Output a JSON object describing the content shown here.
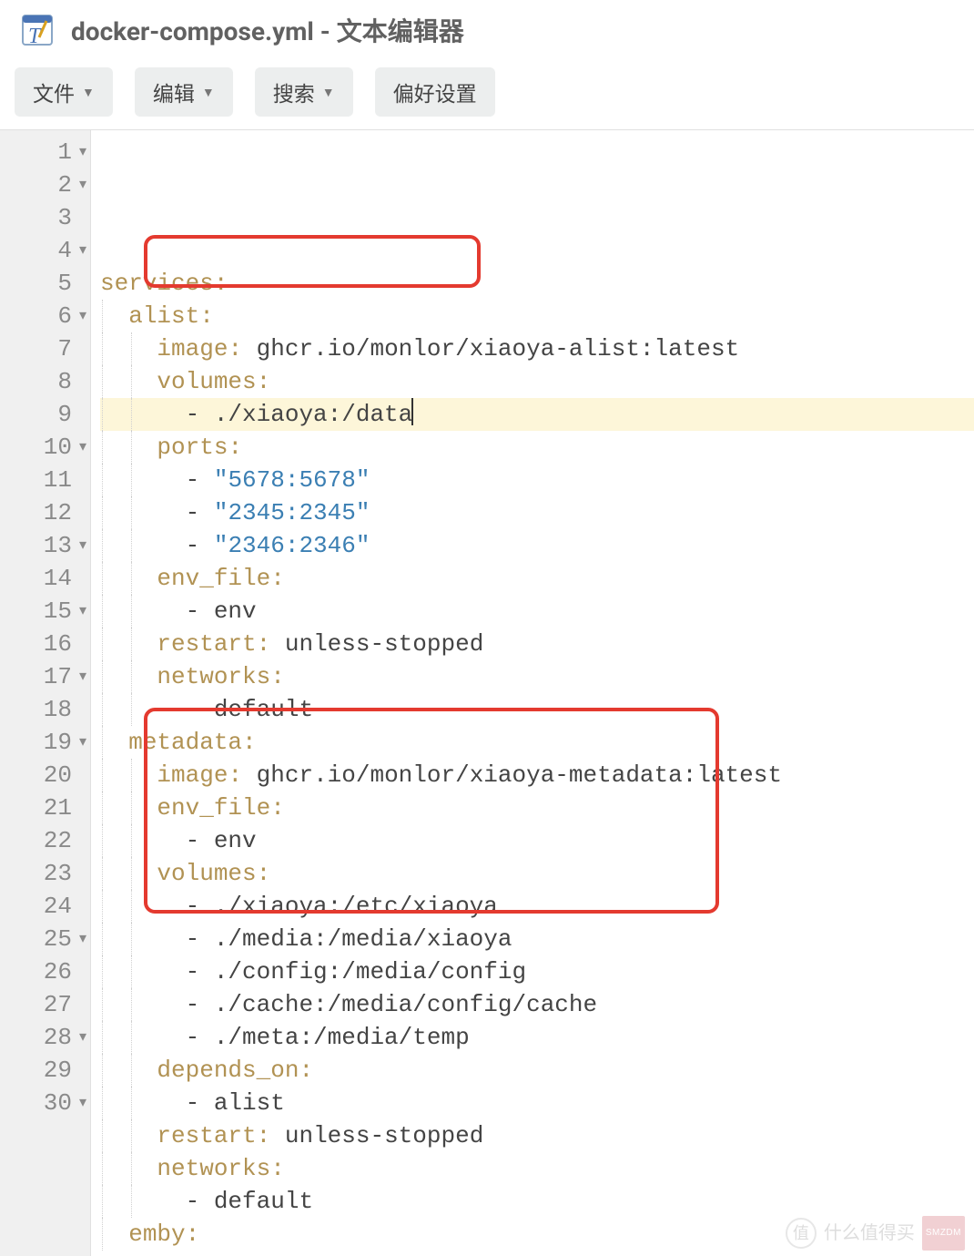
{
  "window": {
    "title": "docker-compose.yml - 文本编辑器"
  },
  "menubar": {
    "file": "文件",
    "edit": "编辑",
    "search": "搜索",
    "prefs": "偏好设置"
  },
  "lines": [
    {
      "n": "1",
      "fold": true,
      "hl": false,
      "indent": 0,
      "segs": [
        {
          "t": "key",
          "v": "services"
        },
        {
          "t": "key",
          "v": ":"
        }
      ]
    },
    {
      "n": "2",
      "fold": true,
      "hl": false,
      "indent": 1,
      "segs": [
        {
          "t": "key",
          "v": "alist"
        },
        {
          "t": "key",
          "v": ":"
        }
      ]
    },
    {
      "n": "3",
      "fold": false,
      "hl": false,
      "indent": 2,
      "segs": [
        {
          "t": "key",
          "v": "image"
        },
        {
          "t": "key",
          "v": ": "
        },
        {
          "t": "plain",
          "v": "ghcr.io/monlor/xiaoya-alist:latest"
        }
      ]
    },
    {
      "n": "4",
      "fold": true,
      "hl": false,
      "indent": 2,
      "segs": [
        {
          "t": "key",
          "v": "volumes"
        },
        {
          "t": "key",
          "v": ":"
        }
      ]
    },
    {
      "n": "5",
      "fold": false,
      "hl": true,
      "indent": 3,
      "cursor": true,
      "segs": [
        {
          "t": "plain",
          "v": "- ./xiaoya:/data"
        }
      ]
    },
    {
      "n": "6",
      "fold": true,
      "hl": false,
      "indent": 2,
      "segs": [
        {
          "t": "key",
          "v": "ports"
        },
        {
          "t": "key",
          "v": ":"
        }
      ]
    },
    {
      "n": "7",
      "fold": false,
      "hl": false,
      "indent": 3,
      "segs": [
        {
          "t": "plain",
          "v": "- "
        },
        {
          "t": "str",
          "v": "\"5678:5678\""
        }
      ]
    },
    {
      "n": "8",
      "fold": false,
      "hl": false,
      "indent": 3,
      "segs": [
        {
          "t": "plain",
          "v": "- "
        },
        {
          "t": "str",
          "v": "\"2345:2345\""
        }
      ]
    },
    {
      "n": "9",
      "fold": false,
      "hl": false,
      "indent": 3,
      "segs": [
        {
          "t": "plain",
          "v": "- "
        },
        {
          "t": "str",
          "v": "\"2346:2346\""
        }
      ]
    },
    {
      "n": "10",
      "fold": true,
      "hl": false,
      "indent": 2,
      "segs": [
        {
          "t": "key",
          "v": "env_file"
        },
        {
          "t": "key",
          "v": ":"
        }
      ]
    },
    {
      "n": "11",
      "fold": false,
      "hl": false,
      "indent": 3,
      "segs": [
        {
          "t": "plain",
          "v": "- env"
        }
      ]
    },
    {
      "n": "12",
      "fold": false,
      "hl": false,
      "indent": 2,
      "segs": [
        {
          "t": "key",
          "v": "restart"
        },
        {
          "t": "key",
          "v": ": "
        },
        {
          "t": "plain",
          "v": "unless-stopped"
        }
      ]
    },
    {
      "n": "13",
      "fold": true,
      "hl": false,
      "indent": 2,
      "segs": [
        {
          "t": "key",
          "v": "networks"
        },
        {
          "t": "key",
          "v": ":"
        }
      ]
    },
    {
      "n": "14",
      "fold": false,
      "hl": false,
      "indent": 3,
      "segs": [
        {
          "t": "plain",
          "v": "- default"
        }
      ]
    },
    {
      "n": "15",
      "fold": true,
      "hl": false,
      "indent": 1,
      "segs": [
        {
          "t": "key",
          "v": "metadata"
        },
        {
          "t": "key",
          "v": ":"
        }
      ]
    },
    {
      "n": "16",
      "fold": false,
      "hl": false,
      "indent": 2,
      "segs": [
        {
          "t": "key",
          "v": "image"
        },
        {
          "t": "key",
          "v": ": "
        },
        {
          "t": "plain",
          "v": "ghcr.io/monlor/xiaoya-metadata:latest"
        }
      ]
    },
    {
      "n": "17",
      "fold": true,
      "hl": false,
      "indent": 2,
      "segs": [
        {
          "t": "key",
          "v": "env_file"
        },
        {
          "t": "key",
          "v": ":"
        }
      ]
    },
    {
      "n": "18",
      "fold": false,
      "hl": false,
      "indent": 3,
      "segs": [
        {
          "t": "plain",
          "v": "- env"
        }
      ]
    },
    {
      "n": "19",
      "fold": true,
      "hl": false,
      "indent": 2,
      "segs": [
        {
          "t": "key",
          "v": "volumes"
        },
        {
          "t": "key",
          "v": ":"
        }
      ]
    },
    {
      "n": "20",
      "fold": false,
      "hl": false,
      "indent": 3,
      "segs": [
        {
          "t": "plain",
          "v": "- ./xiaoya:/etc/xiaoya"
        }
      ]
    },
    {
      "n": "21",
      "fold": false,
      "hl": false,
      "indent": 3,
      "segs": [
        {
          "t": "plain",
          "v": "- ./media:/media/xiaoya"
        }
      ]
    },
    {
      "n": "22",
      "fold": false,
      "hl": false,
      "indent": 3,
      "segs": [
        {
          "t": "plain",
          "v": "- ./config:/media/config"
        }
      ]
    },
    {
      "n": "23",
      "fold": false,
      "hl": false,
      "indent": 3,
      "segs": [
        {
          "t": "plain",
          "v": "- ./cache:/media/config/cache"
        }
      ]
    },
    {
      "n": "24",
      "fold": false,
      "hl": false,
      "indent": 3,
      "segs": [
        {
          "t": "plain",
          "v": "- ./meta:/media/temp"
        }
      ]
    },
    {
      "n": "25",
      "fold": true,
      "hl": false,
      "indent": 2,
      "segs": [
        {
          "t": "key",
          "v": "depends_on"
        },
        {
          "t": "key",
          "v": ":"
        }
      ]
    },
    {
      "n": "26",
      "fold": false,
      "hl": false,
      "indent": 3,
      "segs": [
        {
          "t": "plain",
          "v": "- alist"
        }
      ]
    },
    {
      "n": "27",
      "fold": false,
      "hl": false,
      "indent": 2,
      "segs": [
        {
          "t": "key",
          "v": "restart"
        },
        {
          "t": "key",
          "v": ": "
        },
        {
          "t": "plain",
          "v": "unless-stopped"
        }
      ]
    },
    {
      "n": "28",
      "fold": true,
      "hl": false,
      "indent": 2,
      "segs": [
        {
          "t": "key",
          "v": "networks"
        },
        {
          "t": "key",
          "v": ":"
        }
      ]
    },
    {
      "n": "29",
      "fold": false,
      "hl": false,
      "indent": 3,
      "segs": [
        {
          "t": "plain",
          "v": "- default"
        }
      ]
    },
    {
      "n": "30",
      "fold": true,
      "hl": false,
      "indent": 1,
      "segs": [
        {
          "t": "key",
          "v": "emby"
        },
        {
          "t": "key",
          "v": ":"
        }
      ]
    }
  ],
  "watermark": {
    "char": "值",
    "text": "什么值得买",
    "tag": "SMZDM"
  }
}
